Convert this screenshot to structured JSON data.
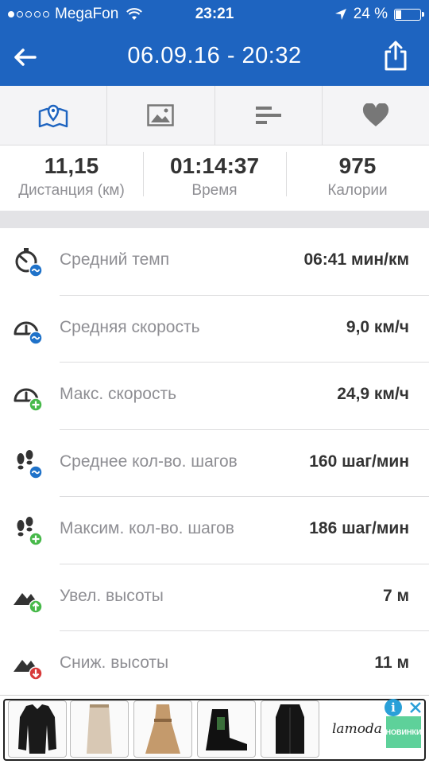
{
  "status_bar": {
    "carrier": "MegaFon",
    "time": "23:21",
    "battery_text": "24 %",
    "battery_level": 0.24,
    "signal_bars": 1,
    "signal_total": 5
  },
  "nav": {
    "title": "06.09.16 - 20:32",
    "back_icon": "arrow-left-icon",
    "share_icon": "share-icon"
  },
  "tabs": [
    {
      "icon": "map-pin-icon",
      "active": true
    },
    {
      "icon": "image-icon",
      "active": false
    },
    {
      "icon": "bar-list-icon",
      "active": false
    },
    {
      "icon": "heart-icon",
      "active": false
    }
  ],
  "summary": {
    "distance": {
      "value": "11,15",
      "label": "Дистанция (км)"
    },
    "time": {
      "value": "01:14:37",
      "label": "Время"
    },
    "calories": {
      "value": "975",
      "label": "Калории"
    }
  },
  "stats": [
    {
      "label": "Средний темп",
      "value": "06:41 мин/км",
      "icon": "stopwatch-average-icon"
    },
    {
      "label": "Средняя скорость",
      "value": "9,0 км/ч",
      "icon": "speedometer-average-icon"
    },
    {
      "label": "Макс. скорость",
      "value": "24,9 км/ч",
      "icon": "speedometer-max-icon"
    },
    {
      "label": "Среднее кол-во. шагов",
      "value": "160 шаг/мин",
      "icon": "footsteps-average-icon"
    },
    {
      "label": "Максим. кол-во. шагов",
      "value": "186 шаг/мин",
      "icon": "footsteps-max-icon"
    },
    {
      "label": "Увел. высоты",
      "value": "7 м",
      "icon": "elevation-gain-icon"
    },
    {
      "label": "Сниж. высоты",
      "value": "11 м",
      "icon": "elevation-loss-icon"
    }
  ],
  "ad": {
    "brand": "lamoda",
    "badge": "НОВИНКИ",
    "info_icon": "i"
  },
  "colors": {
    "brand_blue": "#1e64c0",
    "badge_blue": "#1f72c9",
    "badge_green": "#47b94a",
    "badge_red": "#d83a3a",
    "heart_gray": "#777777"
  }
}
